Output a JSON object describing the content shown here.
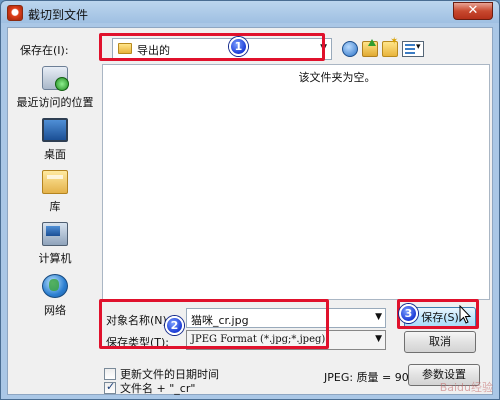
{
  "window": {
    "title": "截切到文件",
    "close_glyph": "✕"
  },
  "toolbar": {
    "save_in_label": "保存在(I):",
    "save_in_value": "导出的",
    "icons": [
      "back-icon",
      "up-folder-icon",
      "new-folder-icon",
      "view-menu-icon"
    ]
  },
  "places": [
    {
      "label": "最近访问的位置",
      "icon": "recent-places-icon"
    },
    {
      "label": "桌面",
      "icon": "desktop-icon"
    },
    {
      "label": "库",
      "icon": "library-icon"
    },
    {
      "label": "计算机",
      "icon": "computer-icon"
    },
    {
      "label": "网络",
      "icon": "network-icon"
    }
  ],
  "filelist": {
    "empty_message": "该文件夹为空。"
  },
  "form": {
    "filename_label": "对象名称(N):",
    "filename_value": "猫咪_cr.jpg",
    "filetype_label": "保存类型(T):",
    "filetype_value": "JPEG Format (*.jpg;*.jpeg)"
  },
  "buttons": {
    "save": "保存(S)",
    "cancel": "取消",
    "options": "参数设置"
  },
  "options": {
    "update_date_label": "更新文件的日期时间",
    "update_date_checked": false,
    "suffix_label": "文件名 + \"_cr\"",
    "suffix_checked": true,
    "quality_label": "JPEG: 质量 = 90"
  },
  "annotations": {
    "step1": "1",
    "step2": "2",
    "step3": "3",
    "color": "#e0112c"
  },
  "watermark": "Baidu经验"
}
